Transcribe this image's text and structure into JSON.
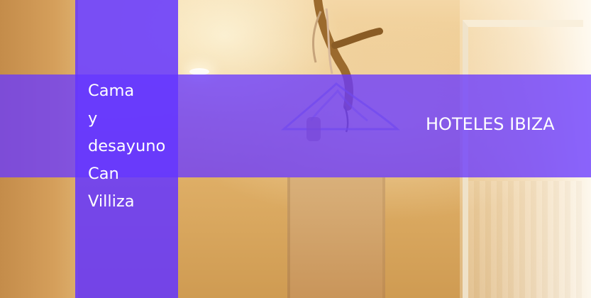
{
  "hero": {
    "title_lines": [
      "Cama",
      "y",
      "desayuno",
      "Can",
      "Villiza"
    ],
    "category_label": "HOTELES IBIZA"
  },
  "colors": {
    "overlay_purple": "#6a36ff",
    "text": "#ffffff",
    "background_warm": "#e2b36b"
  },
  "icons": {
    "decor": "hanging-branch-hanger"
  }
}
